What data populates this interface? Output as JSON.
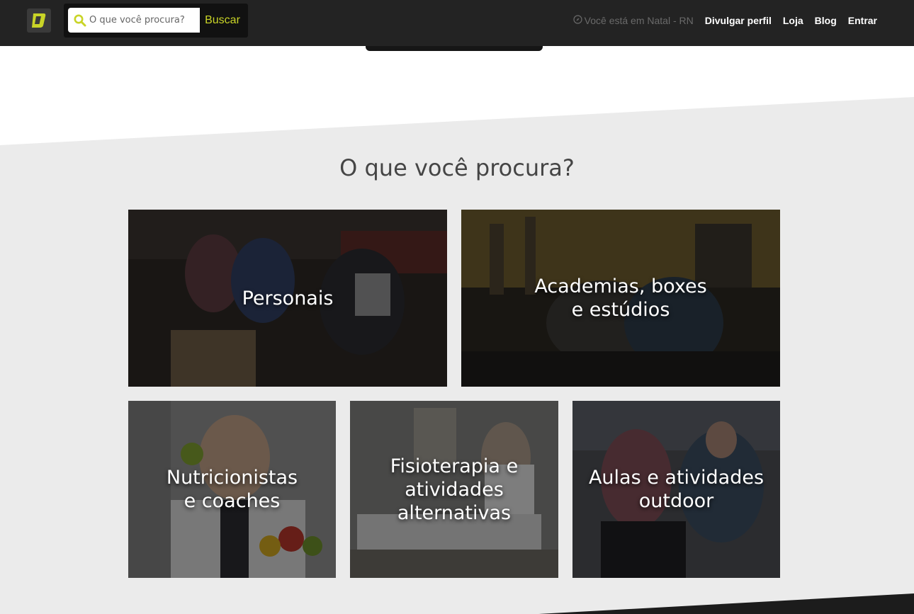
{
  "header": {
    "search": {
      "placeholder": "O que você procura?",
      "button_label": "Buscar"
    },
    "location": "Você está em Natal - RN",
    "nav": [
      "Divulgar perfil",
      "Loja",
      "Blog",
      "Entrar"
    ]
  },
  "section": {
    "title": "O que você procura?"
  },
  "categories": [
    {
      "lines": [
        "Personais"
      ]
    },
    {
      "lines": [
        "Academias, boxes",
        "e estúdios"
      ]
    },
    {
      "lines": [
        "Nutricionistas",
        "e coaches"
      ]
    },
    {
      "lines": [
        "Fisioterapia e",
        "atividades alternativas"
      ]
    },
    {
      "lines": [
        "Aulas e atividades",
        "outdoor"
      ]
    }
  ],
  "colors": {
    "header_bg": "#232323",
    "accent": "#c9d427",
    "section_bg": "#ebebeb"
  },
  "icons": [
    "logo-icon",
    "search-icon",
    "compass-icon"
  ]
}
